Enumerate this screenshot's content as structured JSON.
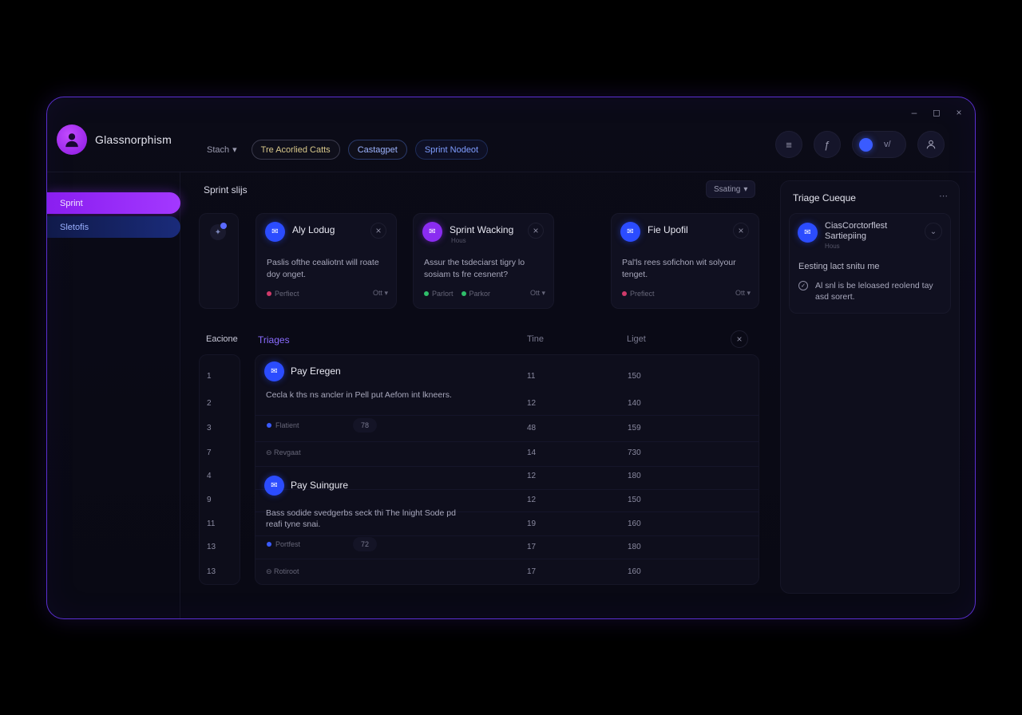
{
  "window": {
    "controls": [
      "–",
      "◻",
      "×"
    ]
  },
  "brand": {
    "name": "Glassnorphism",
    "avatar_icon": "user-silhouette-icon"
  },
  "chips": [
    {
      "label": "Stach",
      "caret": "▾"
    },
    {
      "label": "Tre Acorlied Catts"
    },
    {
      "label": "Castagpet"
    },
    {
      "label": "Sprint Nodeot"
    }
  ],
  "topright": {
    "menu_icon": "≡",
    "info_icon": "ƒ",
    "toggle_label": "v/",
    "user_icon": "user-icon"
  },
  "sidebar": {
    "items": [
      {
        "label": "Sprint"
      },
      {
        "label": "Sletofis"
      }
    ]
  },
  "main": {
    "section_title": "Sprint slijs",
    "sort_label": "Ssating",
    "sort_caret": "▾",
    "cards": [
      {
        "icon": "✉",
        "title": "Aly Lodug",
        "subtitle": "",
        "desc": "Paslis ofthe cealiotnt will roate doy onget.",
        "tags": [
          {
            "label": "Perfiect",
            "color": "#d03a6a"
          }
        ],
        "option": "Ott ▾"
      },
      {
        "icon": "✉",
        "title": "Sprint Wacking",
        "subtitle": "Hous",
        "desc": "Assur the tsdeciarst tigry lo sosiam ts fre cesnent?",
        "tags": [
          {
            "label": "Parlort",
            "color": "#2fbf6a"
          },
          {
            "label": "Parkor",
            "color": "#2fbf6a"
          }
        ],
        "option": "Ott ▾"
      },
      {
        "icon": "✉",
        "title": "Fie Upofil",
        "subtitle": "",
        "desc": "Pal'ls rees sofichon wit solyour tenget.",
        "tags": [
          {
            "label": "Prefiect",
            "color": "#d03a6a"
          }
        ],
        "option": "Ott ▾"
      }
    ]
  },
  "table": {
    "index_header": "Eacione",
    "triages_header": "Triages",
    "time_header": "Tine",
    "last_header": "Liget",
    "rows": [
      {
        "idx": "1",
        "time": "11",
        "last": "150"
      },
      {
        "idx": "2",
        "time": "12",
        "last": "140"
      },
      {
        "idx": "3",
        "time": "48",
        "last": "159"
      },
      {
        "idx": "7",
        "time": "14",
        "last": "730"
      },
      {
        "idx": "4",
        "time": "12",
        "last": "180"
      },
      {
        "idx": "9",
        "time": "12",
        "last": "150"
      },
      {
        "idx": "11",
        "time": "19",
        "last": "160"
      },
      {
        "idx": "13",
        "time": "17",
        "last": "180"
      },
      {
        "idx": "13",
        "time": "17",
        "last": "160"
      }
    ],
    "triage_items": [
      {
        "title": "Pay Eregen",
        "desc": "Cecla k ths ns ancler in Pell put Aefom int lkneers.",
        "tag": "Flatient",
        "num": "78",
        "sub": "⊖ Revgaat"
      },
      {
        "title": "Pay Suingure",
        "desc": "Bass sodide svedgerbs seck thi The lnight Sode pd reafi tyne snai.",
        "tag": "Portfest",
        "num": "72",
        "sub": "⊖ Rotiroot"
      }
    ]
  },
  "rpanel": {
    "title": "Triage Cueque",
    "more": "⋯",
    "card": {
      "title": "CiasCorctorflest Sartiepiing",
      "subtitle": "Hous",
      "chev": "⌄",
      "line1": "Eesting lact snitu me",
      "bullet": "✓",
      "line2": "Al snl is be leloased reolend tay asd sorert."
    }
  }
}
